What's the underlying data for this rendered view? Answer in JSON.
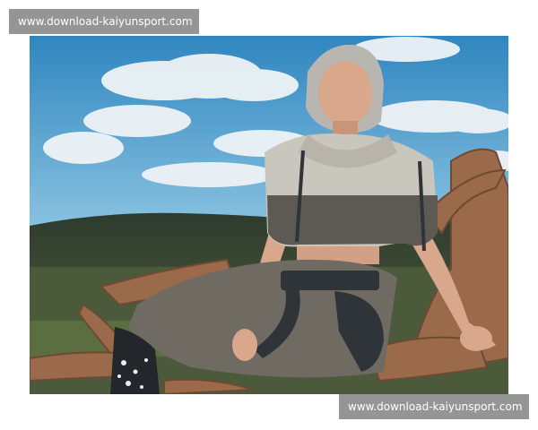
{
  "watermarks": {
    "top": "www.download-kaiyunsport.com",
    "bottom": "www.download-kaiyunsport.com"
  },
  "photo": {
    "subject": "fashion-photo",
    "colors": {
      "sky_top": "#2f86bf",
      "sky_bottom": "#8cc4e2",
      "cloud": "#eef3f6",
      "hills": "#2c3a2e",
      "field": "#5b6e3f",
      "driftwood": "#9a6a4a",
      "sweater_light": "#c9c6bd",
      "sweater_dark": "#5d5a54",
      "skirt": "#6f6a62",
      "leather": "#2e3438",
      "skin": "#d9a78c",
      "hair": "#b9b6b2"
    }
  }
}
